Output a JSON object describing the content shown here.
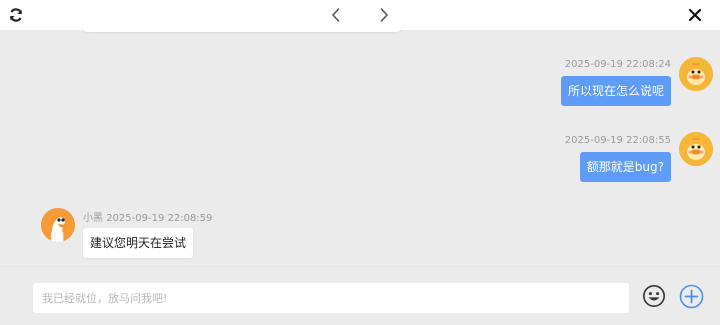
{
  "messages": [
    {
      "sender": "me",
      "time": "2025-09-19 22:08:24",
      "text": "所以现在怎么说呢"
    },
    {
      "sender": "me",
      "time": "2025-09-19 22:08:55",
      "text": "额那就是bug?"
    },
    {
      "sender": "other",
      "sender_name": "小黑",
      "time": "2025-09-19 22:08:59",
      "text": "建议您明天在尝试"
    }
  ],
  "composer": {
    "placeholder": "我已经就位，放马问我吧!"
  },
  "colors": {
    "my_bubble": "#5f9cf8",
    "accent": "#5f9cf8"
  },
  "icons": {
    "refresh": "refresh-icon",
    "prev": "chevron-left-icon",
    "next": "chevron-right-icon",
    "close": "close-icon",
    "emoji": "smiley-icon",
    "add": "plus-circle-icon"
  }
}
